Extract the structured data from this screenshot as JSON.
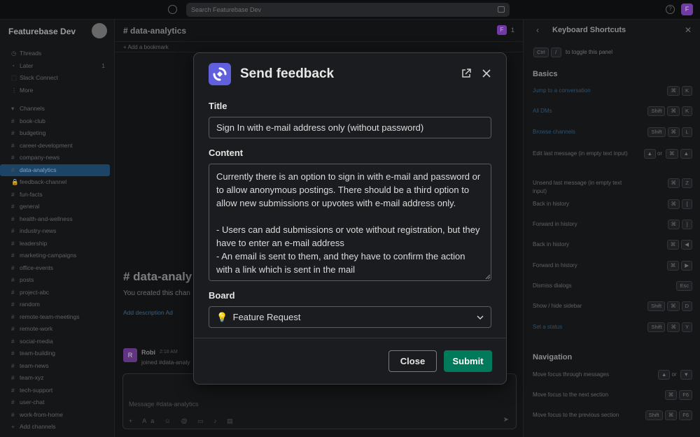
{
  "topbar": {
    "search_placeholder": "Search Featurebase Dev",
    "user_initial": "F"
  },
  "sidebar": {
    "workspace": "Featurebase Dev",
    "nav": [
      "Threads",
      "Later",
      "Slack Connect",
      "More"
    ],
    "later_count": "1",
    "channels_header": "Channels",
    "channels": [
      "book-club",
      "budgeting",
      "career-development",
      "company-news",
      "data-analytics",
      "feedback-channel",
      "fun-facts",
      "general",
      "health-and-wellness",
      "industry-news",
      "leadership",
      "marketing-campaigns",
      "office-events",
      "posts",
      "project-abc",
      "random",
      "remote-team-meetings",
      "remote-work",
      "social-media",
      "team-building",
      "team-news",
      "team-xyz",
      "tech-support",
      "user-chat",
      "work-from-home"
    ],
    "active_channel": "data-analytics",
    "add_channels": "Add channels"
  },
  "main": {
    "channel_title": "# data-analytics",
    "member_count": "1",
    "bookmark": "+ Add a bookmark",
    "big_title": "# data-analy",
    "created": "You created this chan",
    "add_links": "Add description   Ad",
    "message": {
      "avatar": "R",
      "name": "Robi",
      "time": "2:18 AM",
      "text": "joined #data-analy"
    },
    "composer_placeholder": "Message #data-analytics"
  },
  "shortcuts": {
    "title": "Keyboard Shortcuts",
    "toggle_keys": [
      "Ctrl",
      "/"
    ],
    "toggle_text": "to toggle this panel",
    "basics_header": "Basics",
    "basics": [
      {
        "label": "Jump to a conversation",
        "keys": [
          "⌘",
          "K"
        ],
        "link": true
      },
      {
        "label": "All DMs",
        "keys": [
          "Shift",
          "⌘",
          "K"
        ],
        "link": true
      },
      {
        "label": "Browse channels",
        "keys": [
          "Shift",
          "⌘",
          "L"
        ],
        "link": true
      },
      {
        "label": "Edit last message (in empty text input)",
        "keys": [
          "▲",
          "or",
          "⌘",
          "▲"
        ],
        "link": false
      },
      {
        "label": "Unsend last message (in empty text input)",
        "keys": [
          "⌘",
          "Z"
        ],
        "link": false
      },
      {
        "label": "Back in history",
        "keys": [
          "⌘",
          "["
        ],
        "link": false
      },
      {
        "label": "Forward in history",
        "keys": [
          "⌘",
          "]"
        ],
        "link": false
      },
      {
        "label": "Back in history",
        "keys": [
          "⌘",
          "◀"
        ],
        "link": false
      },
      {
        "label": "Forward in history",
        "keys": [
          "⌘",
          "▶"
        ],
        "link": false
      },
      {
        "label": "Dismiss dialogs",
        "keys": [
          "Esc"
        ],
        "link": false
      },
      {
        "label": "Show / hide sidebar",
        "keys": [
          "Shift",
          "⌘",
          "D"
        ],
        "link": false
      },
      {
        "label": "Set a status",
        "keys": [
          "Shift",
          "⌘",
          "Y"
        ],
        "link": true
      }
    ],
    "navigation_header": "Navigation",
    "navigation": [
      {
        "label": "Move focus through messages",
        "keys": [
          "▲",
          "or",
          "▼"
        ]
      },
      {
        "label": "Move focus to the next section",
        "keys": [
          "⌘",
          "F6"
        ]
      },
      {
        "label": "Move focus to the previous section",
        "keys": [
          "Shift",
          "⌘",
          "F6"
        ]
      }
    ]
  },
  "modal": {
    "title": "Send feedback",
    "title_label": "Title",
    "title_value": "Sign In with e-mail address only (without password)",
    "content_label": "Content",
    "content_value": "Currently there is an option to sign in with e-mail and password or to allow anonymous postings. There should be a third option to allow new submissions or upvotes with e-mail address only.\n\n- Users can add submissions or vote without registration, but they have to enter an e-mail address\n- An email is sent to them, and they have to confirm the action with a link which is sent in the mail",
    "board_label": "Board",
    "board_value": "Feature Request",
    "board_emoji": "💡",
    "close_label": "Close",
    "submit_label": "Submit",
    "accent": "#6160dc",
    "submit_color": "#007a5a"
  }
}
